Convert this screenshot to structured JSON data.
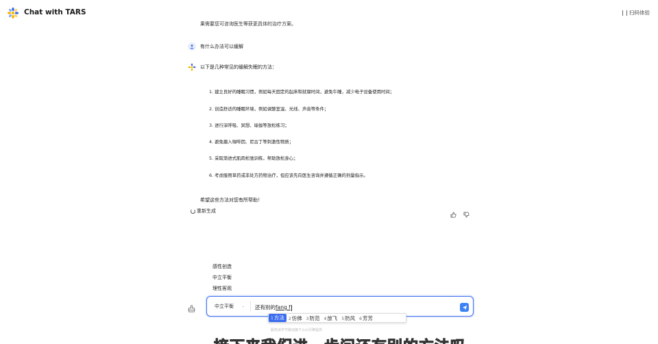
{
  "header": {
    "title": "Chat with TARS",
    "scan_label": "扫码体验"
  },
  "conversation": {
    "partial_prev_text": "果需要您可咨询医生等获更具体的治疗方案。",
    "user_question": "有什么办法可以缓解",
    "bot_intro": "以下是几种常见的缓解失眠的方法：",
    "list_items": [
      "1. 建立良好的睡眠习惯，例如每天固定的起床和就寝时间，避免午睡，减少电子设备使用时间；",
      "2. 创造舒适的睡眠环境，例如调整室温、光线、声音等条件；",
      "3. 进行深呼吸、冥想、瑜伽等放松练习；",
      "4. 避免摄入咖啡因、尼古丁等刺激性物质；",
      "5. 采取渐进式肌肉松弛训练，帮助放松身心；",
      "6. 考虑服用草药或非处方药物治疗，但应该先向医生咨询并遵循正确的剂量指示。"
    ],
    "closing": "希望这些方法对您有所帮助！",
    "regenerate_label": "重新生成"
  },
  "style_menu": {
    "options": [
      "感性创造",
      "中立平衡",
      "理性客观"
    ]
  },
  "input": {
    "style_selected": "中立平衡",
    "committed_text": "还有别的",
    "composing_text": "fang f"
  },
  "ime": {
    "candidates": [
      {
        "num": "1",
        "text": "方法"
      },
      {
        "num": "2",
        "text": "仿佛"
      },
      {
        "num": "3",
        "text": "防范"
      },
      {
        "num": "4",
        "text": "放飞"
      },
      {
        "num": "5",
        "text": "防风"
      },
      {
        "num": "6",
        "text": "芳芳"
      }
    ]
  },
  "footer_note": "服务由字节跳动旗下火山引擎提供",
  "video_subtitle": "接下来我们进一步问还有别的方法吗",
  "colors": {
    "accent": "#3b6cf0",
    "send": "#3b82f6"
  }
}
